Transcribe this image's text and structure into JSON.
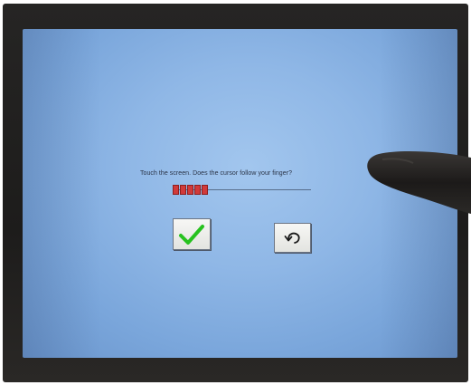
{
  "calibration": {
    "prompt": "Touch the screen. Does the cursor follow your finger?",
    "progress_filled_fraction": 1.0,
    "progress_segments": 5
  },
  "buttons": {
    "accept_icon": "checkmark-icon",
    "undo_icon": "undo-arrow-icon"
  },
  "colors": {
    "screen_background": "#8fb7e6",
    "progress_fill": "#d13a3a",
    "checkmark": "#27c21f",
    "bezel": "#232221"
  }
}
